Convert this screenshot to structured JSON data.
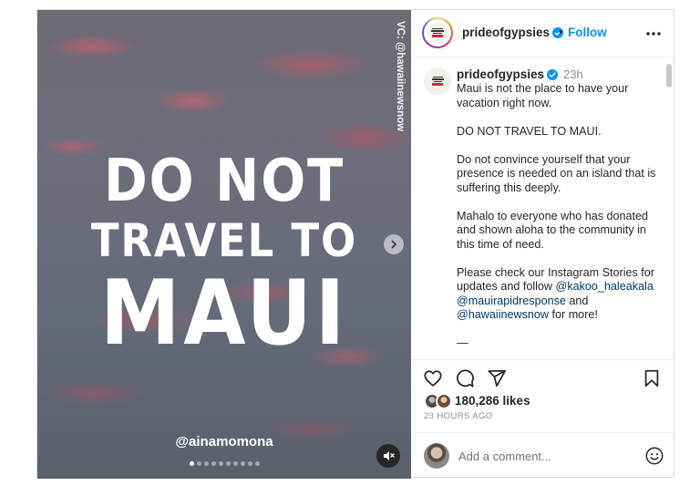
{
  "post": {
    "media": {
      "watermark": "VC: @hawaiinewsnow",
      "headline_line1": "DO NOT",
      "headline_line2": "TRAVEL TO",
      "headline_line3": "MAUI",
      "credit": "@ainamomona",
      "carousel": {
        "total": 10,
        "active_index": 0
      }
    },
    "header": {
      "username": "prideofgypsies",
      "separator": "•",
      "follow_label": "Follow"
    },
    "caption": {
      "username": "prideofgypsies",
      "time": "23h",
      "p1": "Maui is not the place to have your vacation right now.",
      "p2": "DO NOT TRAVEL TO MAUI.",
      "p3": "Do not convince yourself that your presence is needed on an island that is suffering this deeply.",
      "p4": "Mahalo to everyone who has donated and shown aloha to the community in this time of need.",
      "p5_intro": "Please check our Instagram Stories for updates and follow",
      "mention1": "@kakoo_haleakala",
      "mention2": "@mauirapidresponse",
      "and_text": "and",
      "mention3": "@hawaiinewsnow",
      "p5_end": "for more!",
      "dash": "—"
    },
    "likes": "180,286 likes",
    "time_ago": "23 HOURS AGO",
    "comment_placeholder": "Add a comment...",
    "colors": {
      "follow_blue": "#0095f6",
      "mention_link": "#00376b",
      "verified_blue": "#0095f6"
    },
    "icons": [
      "chevron-right-icon",
      "speaker-muted-icon",
      "verified-badge-icon",
      "more-horizontal-icon",
      "heart-icon",
      "comment-icon",
      "share-icon",
      "bookmark-icon",
      "emoji-icon"
    ]
  }
}
